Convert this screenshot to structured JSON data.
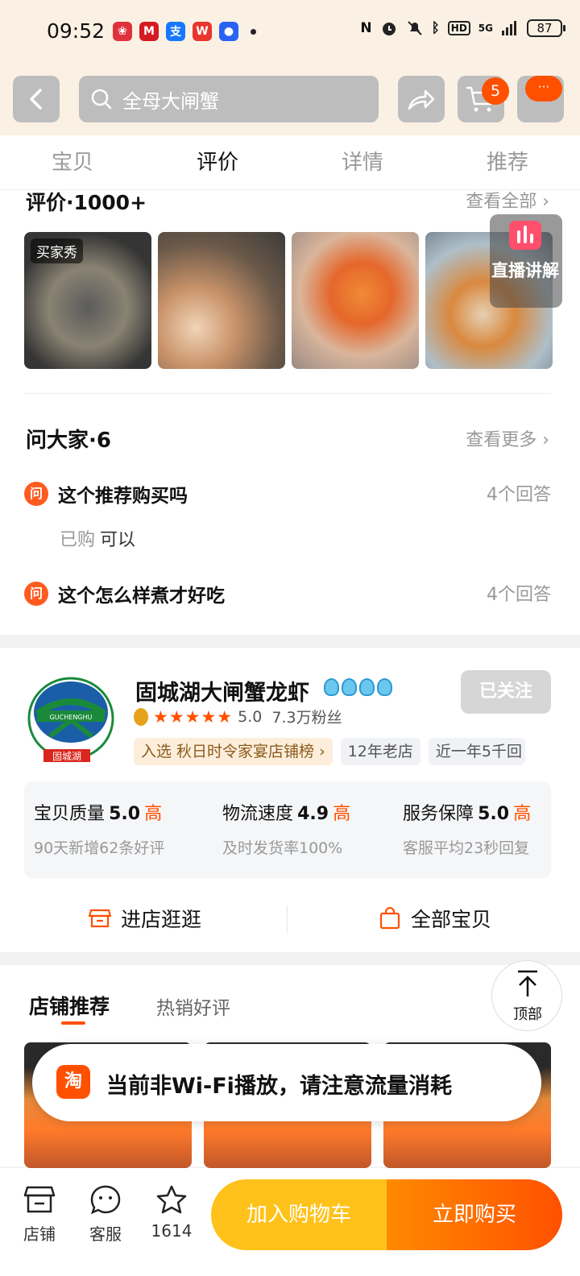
{
  "status_bar": {
    "time": "09:52",
    "battery": "87",
    "network": "5G",
    "app_icons": [
      {
        "name": "app-icon-red-flower",
        "color": "#e0323c",
        "glyph": "❀"
      },
      {
        "name": "app-icon-bank",
        "color": "#d51a21",
        "glyph": "M"
      },
      {
        "name": "app-icon-alipay",
        "color": "#1677ff",
        "glyph": "支"
      },
      {
        "name": "app-icon-wps",
        "color": "#e8352e",
        "glyph": "W"
      },
      {
        "name": "app-icon-blue-circle",
        "color": "#2a62f4",
        "glyph": "●"
      }
    ]
  },
  "header": {
    "search_placeholder": "全母大闸蟹",
    "cart_count": "5",
    "more_label": "···"
  },
  "tabs": [
    {
      "label": "宝贝",
      "active": false
    },
    {
      "label": "评价",
      "active": true
    },
    {
      "label": "详情",
      "active": false
    },
    {
      "label": "推荐",
      "active": false
    }
  ],
  "reviews": {
    "title": "评价·1000+",
    "view_all": "查看全部",
    "buyer_show_label": "买家秀",
    "live_label": "直播讲解"
  },
  "qa": {
    "title": "问大家·6",
    "view_more": "查看更多",
    "icon_label": "问",
    "questions": [
      {
        "question": "这个推荐购买吗",
        "answers": "4个回答",
        "answer_prefix": "已购",
        "answer": "可以"
      },
      {
        "question": "这个怎么样煮才好吃",
        "answers": "4个回答"
      }
    ]
  },
  "store": {
    "name": "固城湖大闸蟹龙虾",
    "follow_label": "已关注",
    "rating": "5.0",
    "followers": "7.3万粉丝",
    "tags": [
      "入选 秋日时令家宴店铺榜 ›",
      "12年老店",
      "近一年5千回"
    ],
    "scores": [
      {
        "label": "宝贝质量",
        "value": "5.0",
        "level": "高",
        "sub": "90天新增62条好评"
      },
      {
        "label": "物流速度",
        "value": "4.9",
        "level": "高",
        "sub": "及时发货率100%"
      },
      {
        "label": "服务保障",
        "value": "5.0",
        "level": "高",
        "sub": "客服平均23秒回复"
      }
    ],
    "enter_store": "进店逛逛",
    "all_items": "全部宝贝",
    "logo_text": "GUCHENGHU",
    "logo_cn": "固城湖"
  },
  "recommend": {
    "tab_active": "店铺推荐",
    "tab_other": "热销好评",
    "top_label": "顶部"
  },
  "toast": {
    "icon": "淘",
    "message": "当前非Wi-Fi播放，请注意流量消耗"
  },
  "bottom_bar": {
    "store_label": "店铺",
    "service_label": "客服",
    "favorites_count": "1614",
    "add_to_cart": "加入购物车",
    "buy_now": "立即购买"
  },
  "colors": {
    "accent": "#ff5000",
    "header_bg": "#faf1e4",
    "cart_button": "#ffc21a"
  }
}
